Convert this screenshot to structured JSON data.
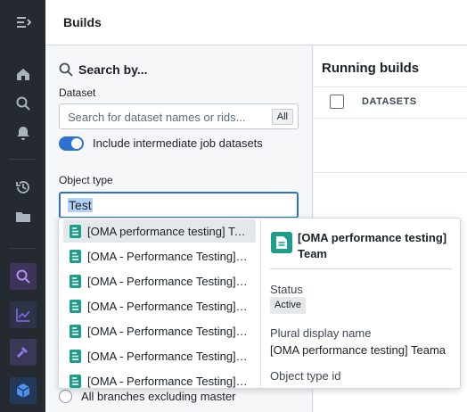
{
  "header": {
    "title": "Builds"
  },
  "rail": {
    "icons": [
      "menu-icon",
      "home-icon",
      "search-icon",
      "bell-icon",
      "history-icon",
      "folder-icon",
      "search-app-icon",
      "chart-icon",
      "hammer-icon",
      "cube-icon"
    ]
  },
  "search": {
    "heading": "Search by...",
    "dataset_label": "Dataset",
    "dataset_placeholder": "Search for dataset names or rids...",
    "scope_tag": "All",
    "toggle_label": "Include intermediate job datasets",
    "toggle_on": true,
    "object_type_label": "Object type",
    "object_type_value": "Test",
    "radio_label": "All branches excluding master"
  },
  "main": {
    "title": "Running builds",
    "column_header": "DATASETS"
  },
  "dropdown": {
    "items": [
      "[OMA performance testing] Team",
      "[OMA - Performance Testing] Team",
      "[OMA - Performance Testing] Team",
      "[OMA - Performance Testing] Team",
      "[OMA - Performance Testing] Team",
      "[OMA - Performance Testing] Team",
      "[OMA - Performance Testing] Team"
    ],
    "detail": {
      "title": "[OMA performance testing] Team",
      "status_label": "Status",
      "status_value": "Active",
      "plural_label": "Plural display name",
      "plural_value": "[OMA performance testing] Teama",
      "id_label": "Object type id"
    }
  },
  "colors": {
    "accent": "#2d72d2",
    "object_icon": "#1c9e8a",
    "rail": "#252a31"
  }
}
